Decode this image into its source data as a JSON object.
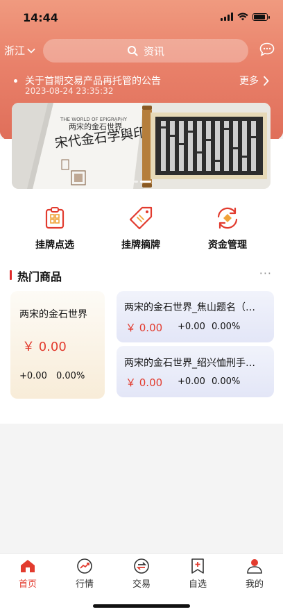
{
  "status": {
    "time": "14:44"
  },
  "header": {
    "region": "浙江",
    "search_placeholder": "资讯"
  },
  "notice": {
    "title": "关于首期交易产品再托管的公告",
    "date": "2023-08-24 23:35:32",
    "more": "更多"
  },
  "banner": {
    "book_title": "宋代金石学與印学",
    "book_subtitle": "两宋的金石世界"
  },
  "shortcuts": [
    {
      "label": "挂牌点选",
      "icon": "listing-select-icon"
    },
    {
      "label": "挂牌摘牌",
      "icon": "listing-delist-icon"
    },
    {
      "label": "资金管理",
      "icon": "fund-management-icon"
    }
  ],
  "section": {
    "title": "热门商品",
    "more": "···"
  },
  "products": [
    {
      "name": "两宋的金石世界",
      "price": "￥ 0.00",
      "change": "+0.00",
      "pct": "0.00%"
    },
    {
      "name": "两宋的金石世界_焦山题名（…",
      "price": "￥ 0.00",
      "change": "+0.00",
      "pct": "0.00%"
    },
    {
      "name": "两宋的金石世界_绍兴恤刑手…",
      "price": "￥ 0.00",
      "change": "+0.00",
      "pct": "0.00%"
    }
  ],
  "tabs": [
    {
      "label": "首页",
      "icon": "home-icon"
    },
    {
      "label": "行情",
      "icon": "market-icon"
    },
    {
      "label": "交易",
      "icon": "trade-icon"
    },
    {
      "label": "自选",
      "icon": "watchlist-icon"
    },
    {
      "label": "我的",
      "icon": "profile-icon"
    }
  ],
  "colors": {
    "accent": "#e23b2e",
    "header": "#e9816a"
  }
}
